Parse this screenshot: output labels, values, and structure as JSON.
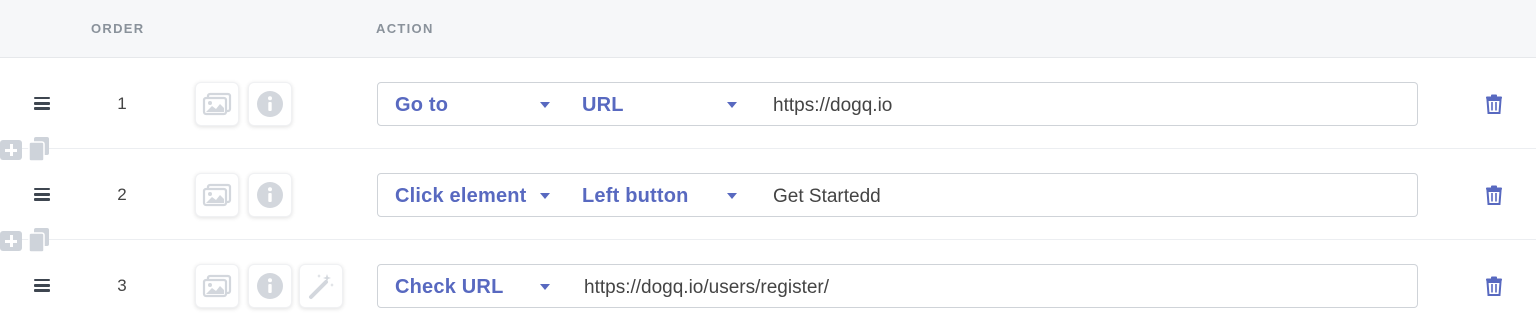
{
  "header": {
    "order_label": "ORDER",
    "action_label": "ACTION"
  },
  "steps": [
    {
      "order": "1",
      "action": "Go to",
      "target": "URL",
      "value": "https://dogq.io",
      "icons": [
        "image-icon",
        "info-icon"
      ]
    },
    {
      "order": "2",
      "action": "Click element",
      "target": "Left button",
      "value": "Get Startedd",
      "icons": [
        "image-icon",
        "info-icon"
      ]
    },
    {
      "order": "3",
      "action": "Check URL",
      "value": "https://dogq.io/users/register/",
      "icons": [
        "image-icon",
        "info-icon",
        "magic-wand-icon"
      ]
    }
  ],
  "colors": {
    "accent": "#5869c0",
    "header_bg": "#f6f7f9",
    "icon_gray": "#ced3da",
    "trash": "#5869c0"
  }
}
